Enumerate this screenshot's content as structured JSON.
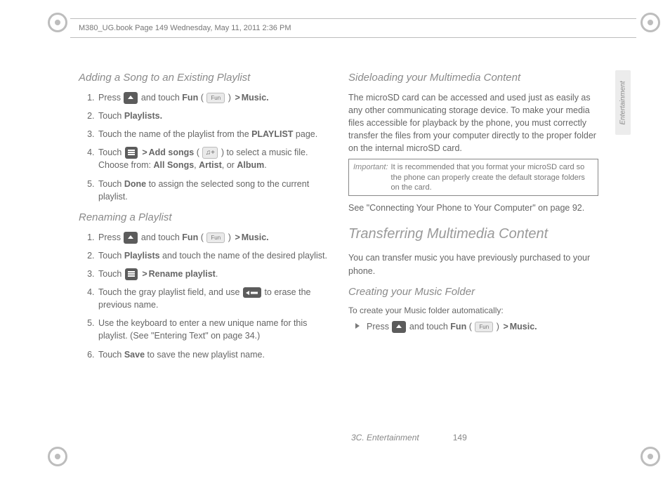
{
  "header": {
    "stamp": "M380_UG.book  Page 149  Wednesday, May 11, 2011  2:36 PM"
  },
  "sideTab": "Entertainment",
  "left": {
    "h1": "Adding a Song to an Existing Playlist",
    "s1": {
      "a": "Press ",
      "b": " and touch ",
      "fun": "Fun",
      "c": " ( ",
      "d": " ) ",
      "gt": ">",
      "music": "Music."
    },
    "s2": {
      "a": "Touch ",
      "b": "Playlists."
    },
    "s3": {
      "a": "Touch the name of the playlist from the ",
      "b": "PLAYLIST",
      "c": " page."
    },
    "s4": {
      "a": "Touch ",
      "gt": ">",
      "add": "Add songs",
      "b": " ( ",
      "c": " ) to select a music file. Choose from: ",
      "all": "All Songs",
      "comma1": ", ",
      "artist": "Artist",
      "comma2": ", or ",
      "album": "Album",
      "dot": "."
    },
    "s5": {
      "a": "Touch ",
      "done": "Done",
      "b": " to assign the selected song to the current playlist."
    },
    "h2": "Renaming a Playlist",
    "r1": {
      "a": "Press ",
      "b": " and touch ",
      "fun": "Fun",
      "c": " ( ",
      "d": " ) ",
      "gt": ">",
      "music": "Music."
    },
    "r2": {
      "a": "Touch ",
      "pl": "Playlists",
      "b": " and touch the name of the desired playlist."
    },
    "r3": {
      "a": "Touch ",
      "gt": ">",
      "ren": "Rename playlist",
      "dot": "."
    },
    "r4": {
      "a": "Touch the gray playlist field, and use ",
      "b": " to erase the previous name."
    },
    "r5": "Use the keyboard to enter a new unique name for this playlist. (See \"Entering Text\" on page 34.)",
    "r6": {
      "a": "Touch ",
      "save": "Save",
      "b": " to save the new playlist name."
    }
  },
  "right": {
    "h1": "Sideloading your Multimedia Content",
    "p1": "The microSD card can be accessed and used just as easily as any other communicating storage device. To make your media files accessible for playback by the phone, you must correctly transfer the files from your computer directly to the proper folder on the internal microSD card.",
    "imp_label": "Important:",
    "imp_text": "It is recommended that you format your microSD card so the phone can properly create the default storage folders on the card.",
    "p2": "See \"Connecting Your Phone to Your Computer\" on page 92.",
    "h2": "Transferring Multimedia Content",
    "p3": "You can transfer music you have previously purchased to your phone.",
    "h3": "Creating your Music Folder",
    "p4": "To create your Music folder automatically:",
    "step": {
      "a": "Press ",
      "b": " and touch ",
      "fun": "Fun",
      "c": " ( ",
      "d": " ) ",
      "gt": ">",
      "music": "Music."
    }
  },
  "footer": {
    "section": "3C. Entertainment",
    "page": "149"
  },
  "icons": {
    "fun": "Fun",
    "music": "♫+"
  }
}
